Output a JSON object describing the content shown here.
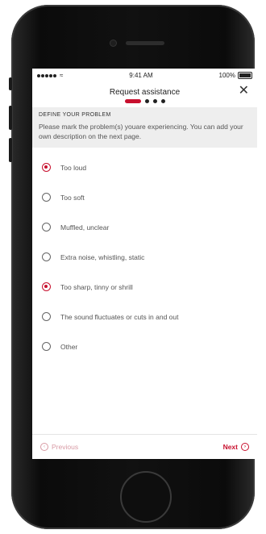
{
  "statusbar": {
    "time": "9:41 AM",
    "battery": "100%"
  },
  "header": {
    "title": "Request assistance",
    "close_icon": "close-icon"
  },
  "steps": {
    "current": 1,
    "total": 4
  },
  "intro": {
    "heading": "DEFINE YOUR PROBLEM",
    "text": "Please mark the problem(s) youare experiencing. You can add your own description on the next page."
  },
  "options": [
    {
      "label": "Too loud",
      "checked": true
    },
    {
      "label": "Too soft",
      "checked": false
    },
    {
      "label": "Muffled, unclear",
      "checked": false
    },
    {
      "label": "Extra noise, whistling, static",
      "checked": false
    },
    {
      "label": "Too sharp, tinny or shrill",
      "checked": true
    },
    {
      "label": "The sound fluctuates or cuts in and out",
      "checked": false
    },
    {
      "label": "Other",
      "checked": false
    }
  ],
  "footer": {
    "previous_label": "Previous",
    "next_label": "Next"
  },
  "colors": {
    "accent": "#c8102e",
    "muted_accent": "#d89aa4",
    "intro_bg": "#eeeeee"
  }
}
